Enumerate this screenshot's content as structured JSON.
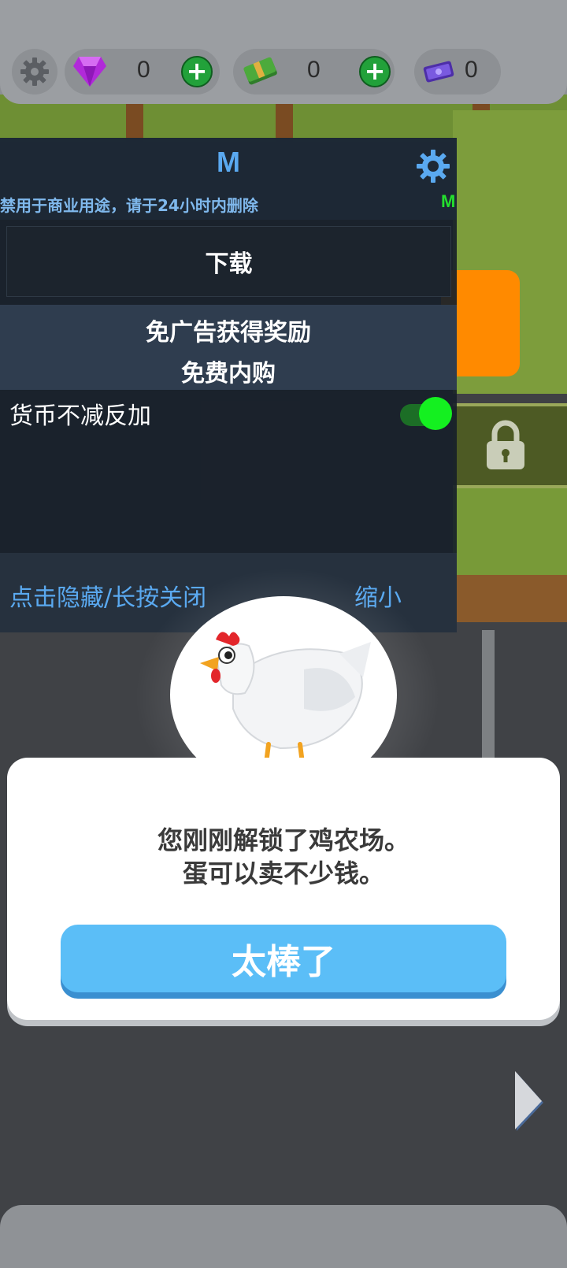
{
  "topbar": {
    "gems": "0",
    "cash": "0",
    "tickets": "0",
    "plus": "+"
  },
  "menu": {
    "title": "M",
    "subtitle": "禁用于商业用途，请于24小时内删除",
    "side_mark": "M",
    "download": "下载",
    "categories": [
      "免广告获得奖励",
      "免费内购"
    ],
    "toggle": {
      "label": "货币不减反加",
      "on": true
    },
    "footer_left": "点击隐藏/长按关闭",
    "footer_right": "缩小"
  },
  "popup": {
    "line1": "您刚刚解锁了鸡农场。",
    "line2": "蛋可以卖不少钱。",
    "button": "太棒了"
  },
  "colors": {
    "accent_blue": "#5aa9f0",
    "toggle_on": "#14f020",
    "popup_button": "#5bbef7",
    "orange_button": "#ff8a00",
    "plus_green": "#22a13a"
  },
  "icons": [
    "gear-icon",
    "gem-icon",
    "cash-icon",
    "ticket-icon",
    "plus-icon",
    "lock-icon",
    "arrow-right-icon",
    "chicken-illustration"
  ]
}
